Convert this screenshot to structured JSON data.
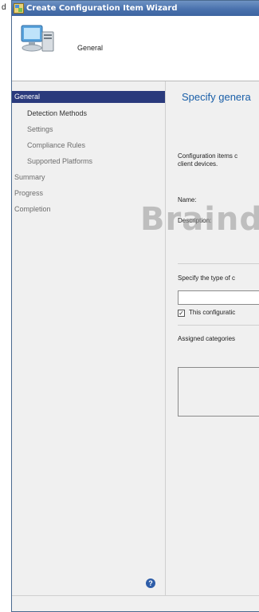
{
  "outside_fragment": "d",
  "window": {
    "title": "Create Configuration Item Wizard"
  },
  "header": {
    "title": "General"
  },
  "nav": {
    "items": [
      {
        "label": "General"
      },
      {
        "label": "Detection Methods"
      },
      {
        "label": "Settings"
      },
      {
        "label": "Compliance Rules"
      },
      {
        "label": "Supported Platforms"
      },
      {
        "label": "Summary"
      },
      {
        "label": "Progress"
      },
      {
        "label": "Completion"
      }
    ]
  },
  "content": {
    "heading": "Specify genera",
    "intro_line1": "Configuration items c",
    "intro_line2": "client devices.",
    "name_label": "Name:",
    "description_label": "Description:",
    "type_label": "Specify the type of c",
    "checkbox_label": "This configuratic",
    "categories_label": "Assigned categories"
  },
  "watermark": "Braind",
  "icons": {
    "app": "wizard-app-icon",
    "header": "computer-config-icon",
    "help": "help-icon"
  },
  "colors": {
    "titlebar": "#4a72ad",
    "nav_active": "#2a3a7c",
    "heading": "#1a5fa8"
  }
}
